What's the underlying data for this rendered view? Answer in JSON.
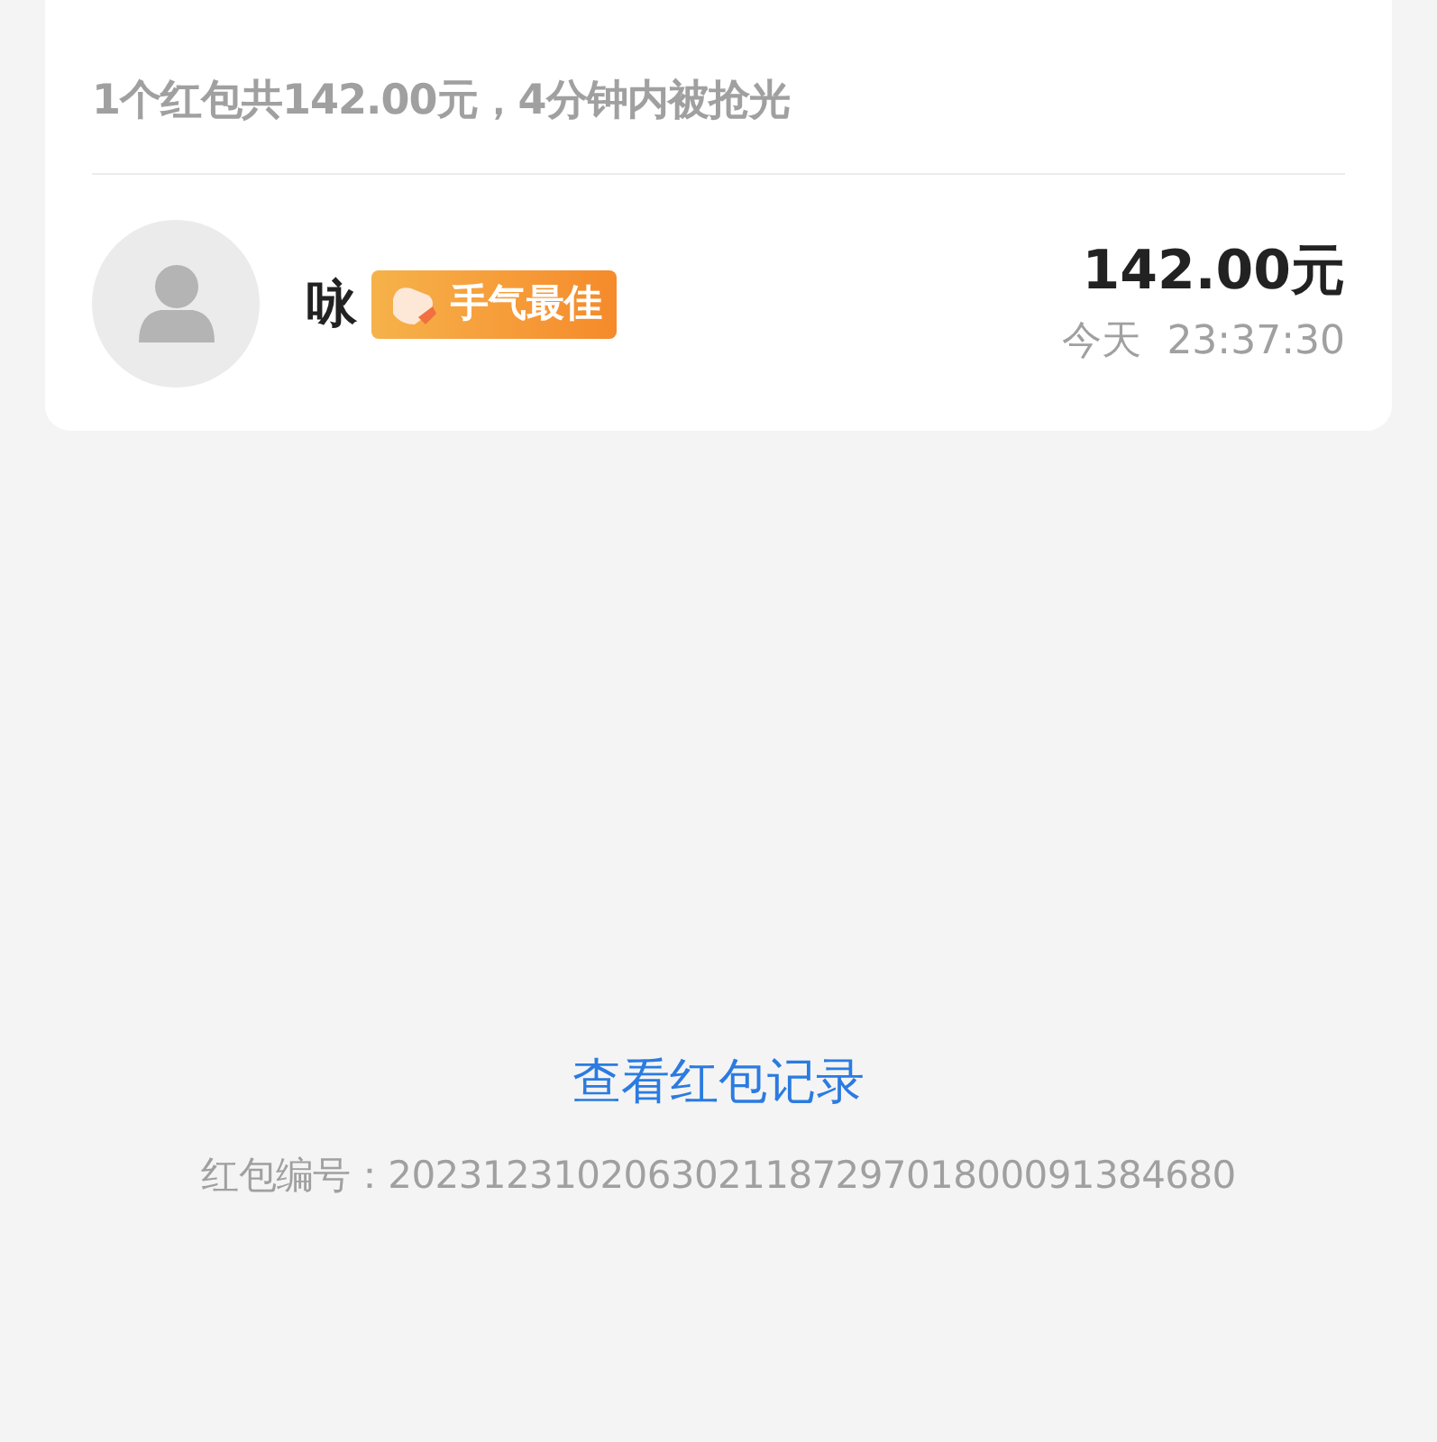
{
  "summary": "1个红包共142.00元，4分钟内被抢光",
  "records": [
    {
      "name": "咏",
      "badge": "手气最佳",
      "best": true,
      "amount": "142.00元",
      "time": "今天  23:37:30"
    }
  ],
  "record_link": "查看红包记录",
  "serial": {
    "label": "红包编号：",
    "value": "202312310206302118729701800091384680"
  }
}
